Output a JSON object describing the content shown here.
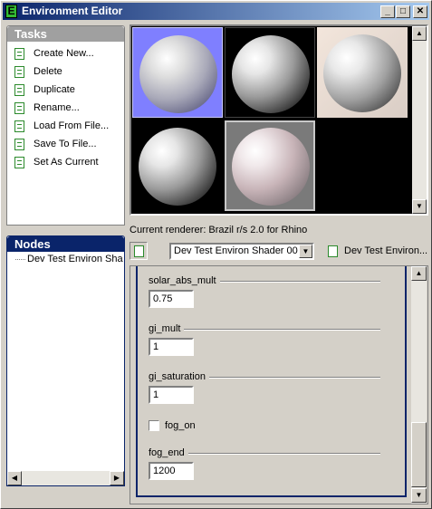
{
  "window": {
    "title": "Environment Editor",
    "icon": "app-e-icon",
    "title_gradient": [
      "#0a246a",
      "#a6caf0"
    ]
  },
  "title_buttons": {
    "minimize": "_",
    "maximize": "□",
    "close": "✕"
  },
  "tasks": {
    "heading": "Tasks",
    "items": [
      {
        "label": "Create New...",
        "icon": "task-icon"
      },
      {
        "label": "Delete",
        "icon": "task-icon"
      },
      {
        "label": "Duplicate",
        "icon": "task-icon"
      },
      {
        "label": "Rename...",
        "icon": "task-icon"
      },
      {
        "label": "Load From File...",
        "icon": "task-icon"
      },
      {
        "label": "Save To File...",
        "icon": "task-icon"
      },
      {
        "label": "Set As Current",
        "icon": "task-icon"
      }
    ]
  },
  "nodes": {
    "heading": "Nodes",
    "items": [
      {
        "label": "Dev Test Environ Sha"
      }
    ]
  },
  "preview": {
    "swatches": [
      {
        "background": "#7f7fff"
      },
      {
        "background": "#000000"
      },
      {
        "background": "#efe3da"
      },
      {
        "background": "#000000"
      },
      {
        "background": "#7a7a7a"
      }
    ]
  },
  "renderer_text": "Current renderer: Brazil r/s 2.0 for Rhino",
  "shader": {
    "selected": "Dev Test Environ Shader 00",
    "name": "Dev Test Environ..."
  },
  "properties": {
    "solar_abs_mult": {
      "label": "solar_abs_mult",
      "value": "0.75"
    },
    "gi_mult": {
      "label": "gi_mult",
      "value": "1"
    },
    "gi_saturation": {
      "label": "gi_saturation",
      "value": "1"
    },
    "fog_on": {
      "label": "fog_on",
      "checked": false
    },
    "fog_end": {
      "label": "fog_end",
      "value": "1200"
    }
  },
  "colors": {
    "face": "#d4d0c8",
    "active_heading": "#0a246a",
    "inactive_heading": "#a0a0a0",
    "task_icon": "#2b8a2b"
  }
}
